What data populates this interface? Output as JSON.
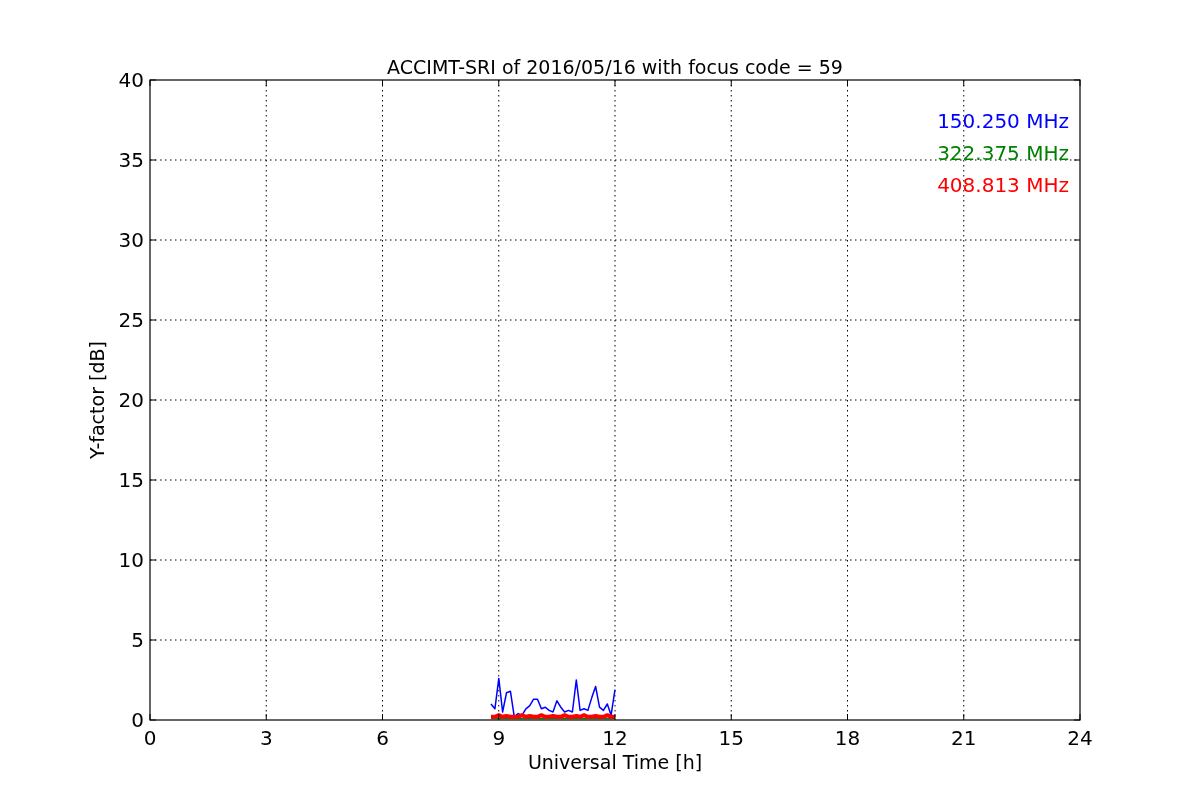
{
  "figure": {
    "chart_data": {
      "type": "line",
      "title": "ACCIMT-SRI of 2016/05/16 with focus code = 59",
      "xlabel": "Universal Time [h]",
      "ylabel": "Y-factor [dB]",
      "x": [
        8.8,
        8.9,
        9.0,
        9.1,
        9.2,
        9.3,
        9.4,
        9.5,
        9.6,
        9.7,
        9.8,
        9.9,
        10.0,
        10.1,
        10.2,
        10.3,
        10.4,
        10.5,
        10.6,
        10.7,
        10.8,
        10.9,
        11.0,
        11.1,
        11.2,
        11.3,
        11.4,
        11.5,
        11.6,
        11.7,
        11.8,
        11.9,
        12.0
      ],
      "series": [
        {
          "name": "150.250 MHz",
          "color": "#0000ff",
          "values": [
            1.0,
            0.7,
            2.6,
            0.5,
            1.7,
            1.8,
            0.2,
            0.4,
            0.3,
            0.7,
            0.9,
            1.3,
            1.3,
            0.7,
            0.8,
            0.6,
            0.5,
            1.2,
            0.8,
            0.5,
            0.6,
            0.5,
            2.5,
            0.6,
            0.7,
            0.6,
            1.4,
            2.1,
            0.8,
            0.6,
            1.0,
            0.3,
            1.9
          ]
        },
        {
          "name": "322.375 MHz",
          "color": "#008000",
          "values": [
            0.1,
            0.1,
            0.1,
            0.1,
            0.1,
            0.1,
            0.1,
            0.1,
            0.1,
            0.1,
            0.1,
            0.1,
            0.1,
            0.1,
            0.1,
            0.1,
            0.1,
            0.1,
            0.1,
            0.1,
            0.1,
            0.1,
            0.1,
            0.1,
            0.1,
            0.1,
            0.1,
            0.1,
            0.1,
            0.1,
            0.1,
            0.1,
            0.1
          ]
        },
        {
          "name": "408.813 MHz",
          "color": "#ff0000",
          "values": [
            0.2,
            0.2,
            0.3,
            0.2,
            0.25,
            0.2,
            0.2,
            0.2,
            0.3,
            0.2,
            0.25,
            0.2,
            0.2,
            0.3,
            0.2,
            0.2,
            0.25,
            0.2,
            0.2,
            0.3,
            0.2,
            0.2,
            0.25,
            0.2,
            0.3,
            0.2,
            0.2,
            0.25,
            0.2,
            0.2,
            0.3,
            0.2,
            0.2
          ]
        }
      ],
      "xlim": [
        0,
        24
      ],
      "ylim": [
        0,
        40
      ],
      "xticks": [
        0,
        3,
        6,
        9,
        12,
        15,
        18,
        21,
        24
      ],
      "yticks": [
        0,
        5,
        10,
        15,
        20,
        25,
        30,
        35,
        40
      ],
      "grid": true
    }
  }
}
